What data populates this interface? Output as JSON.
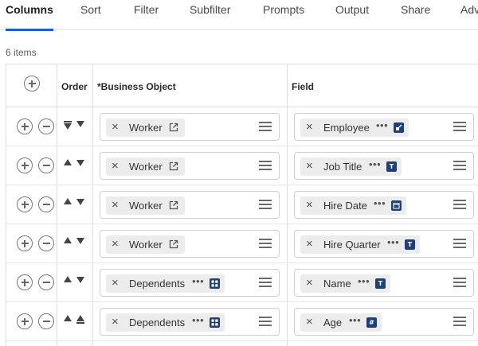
{
  "tabs": [
    {
      "label": "Columns",
      "active": true
    },
    {
      "label": "Sort",
      "active": false
    },
    {
      "label": "Filter",
      "active": false
    },
    {
      "label": "Subfilter",
      "active": false
    },
    {
      "label": "Prompts",
      "active": false
    },
    {
      "label": "Output",
      "active": false
    },
    {
      "label": "Share",
      "active": false
    },
    {
      "label": "Adv",
      "active": false
    }
  ],
  "item_count": "6 items",
  "headers": {
    "order": "Order",
    "business_object": "*Business Object",
    "field": "Field"
  },
  "rows": [
    {
      "business_object": "Worker",
      "bo_type": "external-link-icon",
      "field": "Employee",
      "field_type": "instance-icon",
      "order_state": "first"
    },
    {
      "business_object": "Worker",
      "bo_type": "external-link-icon",
      "field": "Job Title",
      "field_type": "text-icon",
      "order_state": "middle"
    },
    {
      "business_object": "Worker",
      "bo_type": "external-link-icon",
      "field": "Hire Date",
      "field_type": "date-icon",
      "order_state": "middle"
    },
    {
      "business_object": "Worker",
      "bo_type": "external-link-icon",
      "field": "Hire Quarter",
      "field_type": "text-icon",
      "order_state": "middle"
    },
    {
      "business_object": "Dependents",
      "bo_type": "multi-instance-icon",
      "field": "Name",
      "field_type": "text-icon",
      "order_state": "middle"
    },
    {
      "business_object": "Dependents",
      "bo_type": "multi-instance-icon",
      "field": "Age",
      "field_type": "number-icon",
      "order_state": "last"
    }
  ],
  "badge_glyphs": {
    "text-icon": "T",
    "number-icon": "#"
  },
  "colors": {
    "accent": "#1a5bd6",
    "badge": "#1f3f7a"
  }
}
